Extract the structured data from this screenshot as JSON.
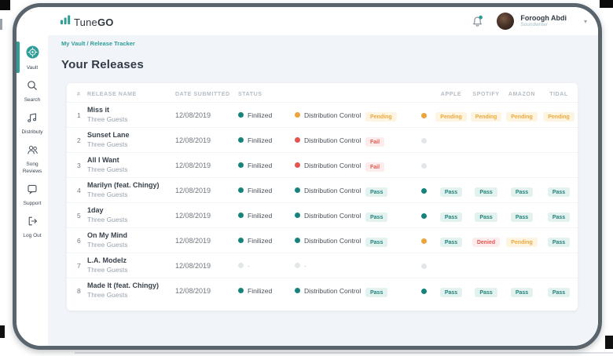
{
  "colors": {
    "brand": "#2f9e98",
    "teal": "#17827b",
    "yellow": "#eaa43b",
    "red": "#e25650",
    "pass_text": "#20837b",
    "pass_bg": "#e3f1ef",
    "pending_text": "#ecaa3f",
    "pending_bg": "#fdf4e1",
    "fail_text": "#e25650",
    "fail_bg": "#fdecec",
    "gray_dot": "#e4e7ea",
    "bezel": "#5a646d",
    "content_bg": "#f1f4f8"
  },
  "topbar": {
    "logo_prefix": "Tune",
    "logo_suffix": "GO",
    "user_name": "Foroogh Abdi",
    "user_role": "Soundwriter"
  },
  "breadcrumb": "My Vault / Release Tracker",
  "page_title": "Your Releases",
  "sidebar": {
    "items": [
      {
        "id": "vault",
        "label": "Vault",
        "active": true
      },
      {
        "id": "search",
        "label": "Search",
        "active": false
      },
      {
        "id": "distributy",
        "label": "Distributy",
        "active": false
      },
      {
        "id": "song-reviews",
        "label": "Song Reviews",
        "active": false
      },
      {
        "id": "support",
        "label": "Support",
        "active": false
      },
      {
        "id": "log-out",
        "label": "Log Out",
        "active": false
      }
    ]
  },
  "table": {
    "columns": {
      "num": "#",
      "name": "RELEASE NAME",
      "date": "DATE SUBMITTED",
      "status": "STATUS",
      "overall": "",
      "dot": "",
      "apple": "APPLE",
      "spotify": "SPOTIFY",
      "amazon": "AMAZON",
      "tidal": "TIDAL"
    },
    "rows": [
      {
        "num": "1",
        "name": "Miss it",
        "artist": "Three Guests",
        "date": "12/08/2019",
        "status": {
          "label": "Finilized",
          "dot": "teal"
        },
        "distribution": {
          "label": "Distribution Control",
          "dot": "yellow"
        },
        "overall": {
          "label": "Pending",
          "type": "pending"
        },
        "dot": "yellow",
        "platforms": [
          {
            "label": "Pending",
            "type": "pending"
          },
          {
            "label": "Pending",
            "type": "pending"
          },
          {
            "label": "Pending",
            "type": "pending"
          },
          {
            "label": "Pending",
            "type": "pending"
          }
        ]
      },
      {
        "num": "2",
        "name": "Sunset Lane",
        "artist": "Three Guests",
        "date": "12/08/2019",
        "status": {
          "label": "Finilized",
          "dot": "teal"
        },
        "distribution": {
          "label": "Distribution Control",
          "dot": "red"
        },
        "overall": {
          "label": "Fail",
          "type": "fail"
        },
        "dot": "gray",
        "platforms": [
          null,
          null,
          null,
          null
        ]
      },
      {
        "num": "3",
        "name": "All I Want",
        "artist": "Three Guests",
        "date": "12/08/2019",
        "status": {
          "label": "Finilized",
          "dot": "teal"
        },
        "distribution": {
          "label": "Distribution Control",
          "dot": "red"
        },
        "overall": {
          "label": "Fail",
          "type": "fail"
        },
        "dot": "gray",
        "platforms": [
          null,
          null,
          null,
          null
        ]
      },
      {
        "num": "4",
        "name": "Marilyn (feat. Chingy)",
        "artist": "Three Guests",
        "date": "12/08/2019",
        "status": {
          "label": "Finilized",
          "dot": "teal"
        },
        "distribution": {
          "label": "Distribution Control",
          "dot": "teal"
        },
        "overall": {
          "label": "Pass",
          "type": "pass"
        },
        "dot": "teal",
        "platforms": [
          {
            "label": "Pass",
            "type": "pass"
          },
          {
            "label": "Pass",
            "type": "pass"
          },
          {
            "label": "Pass",
            "type": "pass"
          },
          {
            "label": "Pass",
            "type": "pass"
          }
        ]
      },
      {
        "num": "5",
        "name": "1day",
        "artist": "Three Guests",
        "date": "12/08/2019",
        "status": {
          "label": "Finilized",
          "dot": "teal"
        },
        "distribution": {
          "label": "Distribution Control",
          "dot": "teal"
        },
        "overall": {
          "label": "Pass",
          "type": "pass"
        },
        "dot": "teal",
        "platforms": [
          {
            "label": "Pass",
            "type": "pass"
          },
          {
            "label": "Pass",
            "type": "pass"
          },
          {
            "label": "Pass",
            "type": "pass"
          },
          {
            "label": "Pass",
            "type": "pass"
          }
        ]
      },
      {
        "num": "6",
        "name": "On My Mind",
        "artist": "Three Guests",
        "date": "12/08/2019",
        "status": {
          "label": "Finilized",
          "dot": "teal"
        },
        "distribution": {
          "label": "Distribution Control",
          "dot": "teal"
        },
        "overall": {
          "label": "Pass",
          "type": "pass"
        },
        "dot": "yellow",
        "platforms": [
          {
            "label": "Pass",
            "type": "pass"
          },
          {
            "label": "Denied",
            "type": "fail"
          },
          {
            "label": "Pending",
            "type": "pending"
          },
          {
            "label": "Pass",
            "type": "pass"
          }
        ]
      },
      {
        "num": "7",
        "name": "L.A. Modelz",
        "artist": "Three Guests",
        "date": "12/08/2019",
        "status": {
          "label": "-",
          "dot": "gray"
        },
        "distribution": {
          "label": "-",
          "dot": "gray"
        },
        "overall": null,
        "dot": "gray",
        "platforms": [
          null,
          null,
          null,
          null
        ]
      },
      {
        "num": "8",
        "name": "Made It (feat. Chingy)",
        "artist": "Three Guests",
        "date": "12/08/2019",
        "status": {
          "label": "Finilized",
          "dot": "teal"
        },
        "distribution": {
          "label": "Distribution Control",
          "dot": "teal"
        },
        "overall": {
          "label": "Pass",
          "type": "pass"
        },
        "dot": "teal",
        "platforms": [
          {
            "label": "Pass",
            "type": "pass"
          },
          {
            "label": "Pass",
            "type": "pass"
          },
          {
            "label": "Pass",
            "type": "pass"
          },
          {
            "label": "Pass",
            "type": "pass"
          }
        ]
      }
    ]
  }
}
